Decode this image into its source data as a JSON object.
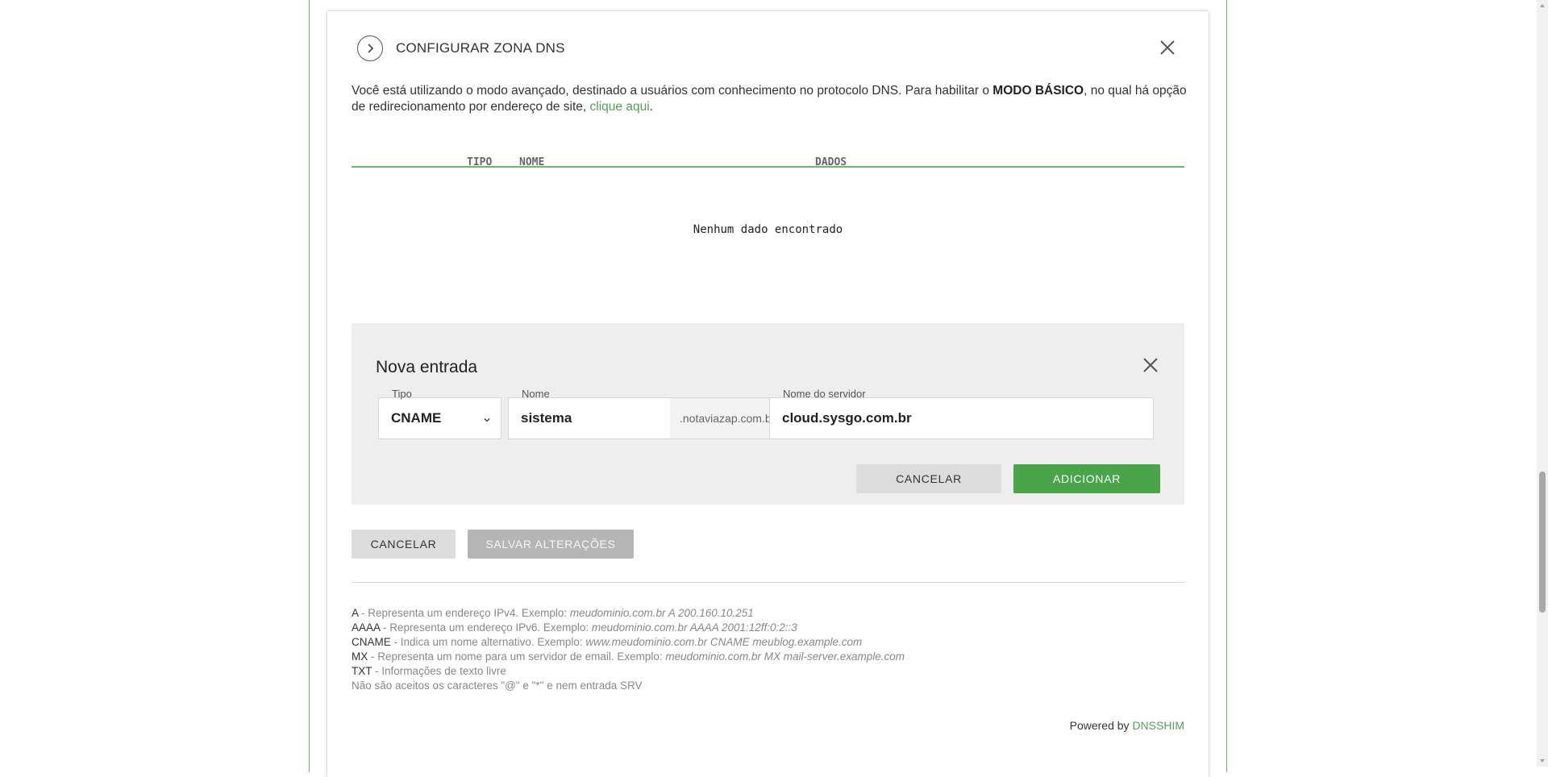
{
  "modal": {
    "title": "CONFIGURAR ZONA DNS",
    "intro_text": "Você está utilizando o modo avançado, destinado a usuários com conhecimento no protocolo DNS. Para habilitar o ",
    "intro_bold": "MODO BÁSICO",
    "intro_text2": ", no qual há opção de redirecionamento por endereço de site, ",
    "intro_link": "clique aqui",
    "intro_end": "."
  },
  "table": {
    "columns": [
      "TIPO",
      "NOME",
      "DADOS"
    ],
    "empty_message": "Nenhum dado encontrado"
  },
  "new_entry": {
    "title": "Nova entrada",
    "tipo_label": "Tipo",
    "tipo_value": "CNAME",
    "nome_label": "Nome",
    "nome_value": "sistema",
    "domain_suffix": ".notaviazap.com.br",
    "server_label": "Nome do servidor",
    "server_value": "cloud.sysgo.com.br",
    "cancel_label": "CANCELAR",
    "add_label": "ADICIONAR"
  },
  "actions": {
    "cancel_label": "CANCELAR",
    "save_label": "SALVAR ALTERAÇÕES"
  },
  "legend": [
    {
      "key": "A",
      "text": " - Representa um endereço IPv4. Exemplo: ",
      "example": "meudominio.com.br A 200.160.10.251"
    },
    {
      "key": "AAAA",
      "text": " - Representa um endereço IPv6. Exemplo: ",
      "example": "meudominio.com.br AAAA 2001:12ff:0:2::3"
    },
    {
      "key": "CNAME",
      "text": " - Indica um nome alternativo. Exemplo: ",
      "example": "www.meudominio.com.br CNAME meublog.example.com"
    },
    {
      "key": "MX",
      "text": " - Representa um nome para um servidor de email. Exemplo: ",
      "example": "meudominio.com.br MX mail-server.example.com"
    },
    {
      "key": "TXT",
      "text": " - Informações de texto livre",
      "example": ""
    }
  ],
  "legend_note": "Não são aceitos os caracteres \"@\" e \"*\" e nem entrada SRV",
  "footer": {
    "powered_by": "Powered by ",
    "brand": "DNSSHIM"
  },
  "colors": {
    "accent_green": "#4aa54a",
    "link_green": "#5a9a5a",
    "frame_green": "#6cb86a"
  },
  "icons": [
    "chevron-right-icon",
    "close-icon",
    "chevron-down-icon"
  ]
}
